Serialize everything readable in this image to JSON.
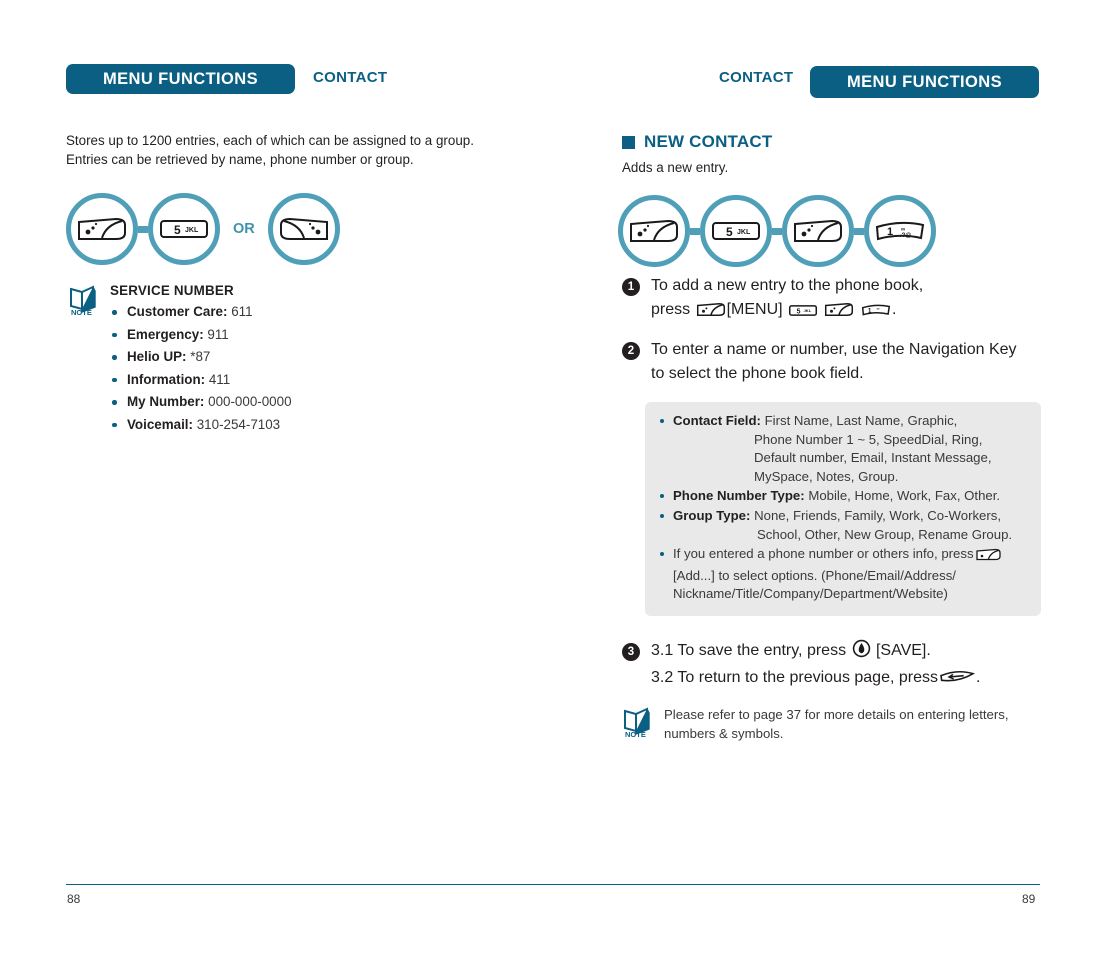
{
  "left_page": {
    "banner_label": "MENU FUNCTIONS",
    "section_label": "CONTACT",
    "intro": "Stores up to 1200 entries, each of which can be assigned to a group. Entries can be retrieved by name, phone number or group.",
    "key_chain": {
      "or_label": "OR",
      "keys": [
        "menu-soft-key",
        "key-5-jkl",
        "back-key"
      ]
    },
    "note": {
      "icon_label": "NOTE",
      "title": "SERVICE NUMBER",
      "items": [
        {
          "label": "Customer Care:",
          "value": "611"
        },
        {
          "label": "Emergency:",
          "value": "911"
        },
        {
          "label": "Helio UP:",
          "value": "*87"
        },
        {
          "label": "Information:",
          "value": "411"
        },
        {
          "label": "My Number:",
          "value": "000-000-0000"
        },
        {
          "label": "Voicemail:",
          "value": "310-254-7103"
        }
      ]
    },
    "page_number": "88"
  },
  "right_page": {
    "banner_label": "MENU FUNCTIONS",
    "section_label": "CONTACT",
    "heading": "NEW CONTACT",
    "lead": "Adds a new entry.",
    "key_chain": {
      "keys": [
        "menu-soft-key",
        "key-5-jkl",
        "menu-soft-key",
        "key-1"
      ]
    },
    "steps": [
      {
        "number": "1",
        "line1": "To add a new entry to the phone book,",
        "line2_pre": "press",
        "line2_menu": "[MENU]",
        "line2_post": "."
      },
      {
        "number": "2",
        "line1": "To enter a name or number, use the Navigation Key",
        "line2": "to select the phone book field."
      },
      {
        "number": "3",
        "line1_pre": "3.1 To save the entry, press",
        "line1_post": "[SAVE].",
        "line2_pre": "3.2 To return to the previous page, press",
        "line2_post": "."
      }
    ],
    "options_box": [
      {
        "label": "Contact Field:",
        "value": "First Name, Last Name, Graphic,",
        "cont": [
          "Phone Number 1 ~ 5, SpeedDial, Ring,",
          "Default number, Email, Instant Message,",
          "MySpace, Notes, Group."
        ]
      },
      {
        "label": "Phone Number Type:",
        "value": "Mobile, Home, Work, Fax, Other.",
        "cont": []
      },
      {
        "label": "Group Type:",
        "value": "None, Friends, Family, Work, Co-Workers,",
        "cont": [
          "School, Other, New Group, Rename Group."
        ]
      },
      {
        "label": "",
        "value": "If you entered a phone number or others info, press",
        "cont": [
          "[Add...] to select options. (Phone/Email/Address/",
          "Nickname/Title/Company/Department/Website)"
        ]
      }
    ],
    "note": {
      "icon_label": "NOTE",
      "text": "Please refer to page 37 for more details on entering letters, numbers & symbols."
    },
    "page_number": "89"
  },
  "colors": {
    "teal_banner": "#0a5f83",
    "teal_ring": "#4f9fb8",
    "gray_box": "#e9e9e9",
    "body_text": "#231f20"
  }
}
